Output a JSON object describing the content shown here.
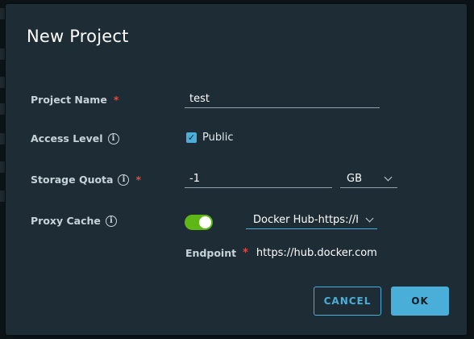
{
  "dialog": {
    "title": "New Project"
  },
  "form": {
    "project_name": {
      "label": "Project Name",
      "required_mark": "*",
      "value": "test"
    },
    "access_level": {
      "label": "Access Level",
      "info_icon": "info-icon",
      "checkbox_label": "Public",
      "checked": true
    },
    "storage_quota": {
      "label": "Storage Quota",
      "required_mark": "*",
      "value": "-1",
      "unit": "GB"
    },
    "proxy_cache": {
      "label": "Proxy Cache",
      "enabled": true,
      "registry": "Docker Hub-https://h",
      "endpoint_label": "Endpoint",
      "endpoint_required_mark": "*",
      "endpoint_value": "https://hub.docker.com"
    }
  },
  "buttons": {
    "cancel": "CANCEL",
    "ok": "OK"
  },
  "colors": {
    "accent": "#49afd9",
    "toggle_on": "#5eb715",
    "required": "#e04b3f",
    "dialog_bg": "#1e2d35"
  }
}
